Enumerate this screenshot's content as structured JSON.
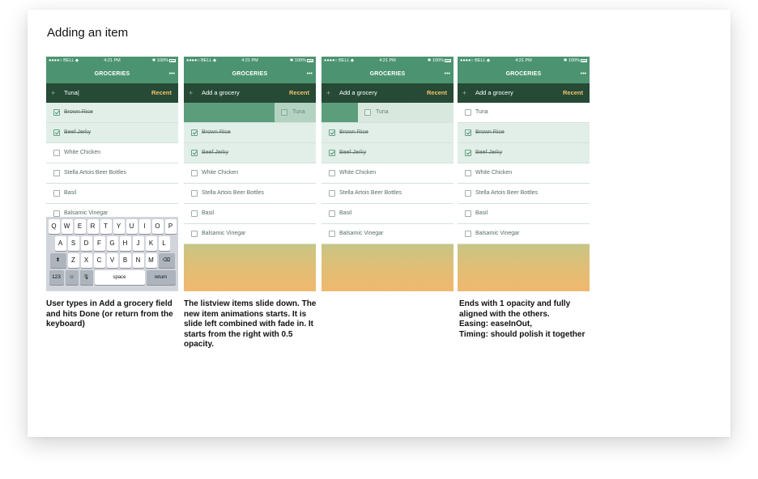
{
  "title": "Adding an item",
  "status": {
    "carrier": "●●●●○ BELL ◆",
    "time": "4:21 PM",
    "battery": "✱ 100%"
  },
  "app": {
    "title": "GROCERIES",
    "menu_icon": "more-dots-icon",
    "menu_glyph": "•••",
    "plus": "+",
    "add_placeholder": "Add a grocery",
    "typed_value": "Tuna|",
    "recent": "Recent"
  },
  "items": {
    "tuna": "Tuna",
    "brown_rice": "Brown Rice",
    "beef_jerky": "Beef Jerky",
    "white_chicken": "White Chicken",
    "stella": "Stella Artois Beer Bottles",
    "basil": "Basil",
    "balsamic": "Balsamic Vinegar"
  },
  "keyboard": {
    "row1": [
      "Q",
      "W",
      "E",
      "R",
      "T",
      "Y",
      "U",
      "I",
      "O",
      "P"
    ],
    "row2": [
      "A",
      "S",
      "D",
      "F",
      "G",
      "H",
      "J",
      "K",
      "L"
    ],
    "row3": [
      "Z",
      "X",
      "C",
      "V",
      "B",
      "N",
      "M"
    ],
    "shift": "⬆",
    "backspace": "⌫",
    "num": "123",
    "emoji": "☺",
    "mic": "🎙",
    "space": "space",
    "return": "return"
  },
  "captions": {
    "step1": "User types in Add a grocery field and hits Done (or return from the keyboard)",
    "step2": "The listview items slide down. The new item animations starts. It is slide left combined with fade in. It starts from the right with 0.5 opacity.",
    "step4_l1": "Ends with 1 opacity and fully aligned with the others.",
    "step4_l2": "Easing: easeInOut,",
    "step4_l3": "Timing: should polish it together"
  }
}
